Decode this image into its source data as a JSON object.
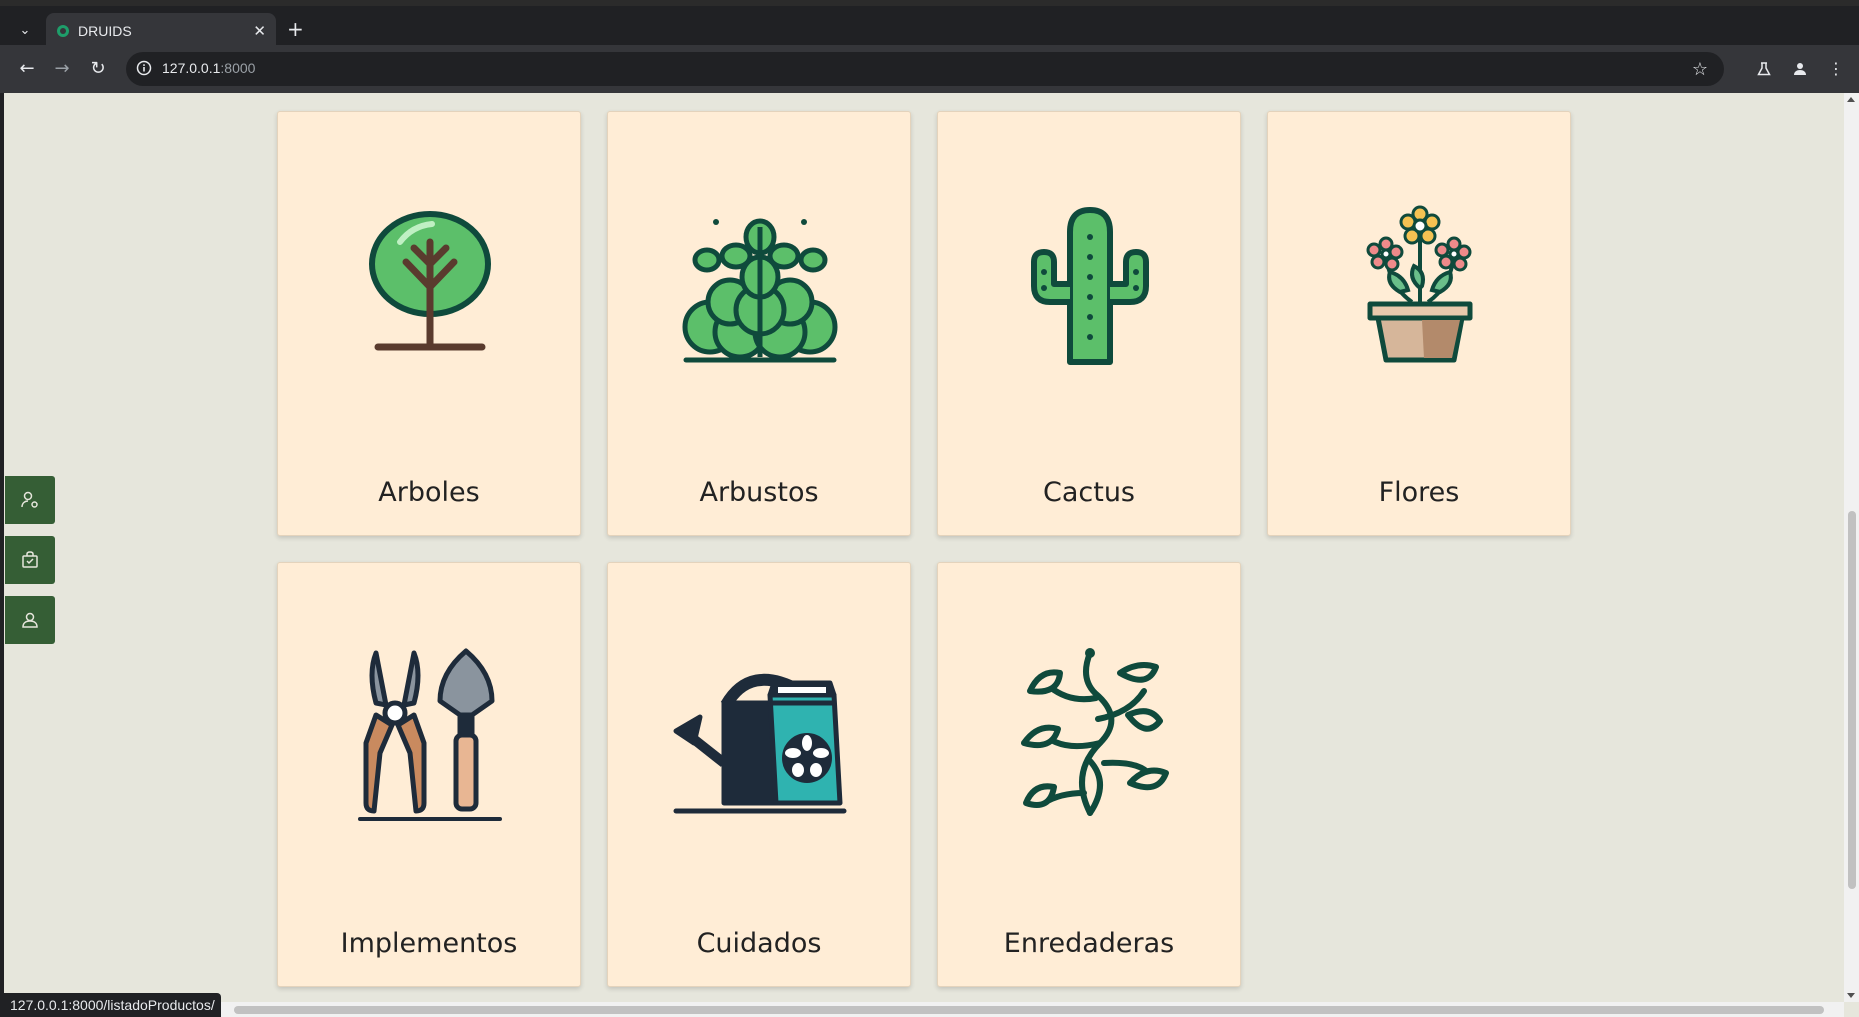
{
  "browser": {
    "tab_title": "DRUIDS",
    "tab_close": "✕",
    "new_tab": "+",
    "url_host": "127.0.0.1",
    "url_port": ":8000",
    "status_url": "127.0.0.1:8000/listadoProductos/"
  },
  "categories": [
    {
      "label": "Arboles",
      "icon": "tree-icon"
    },
    {
      "label": "Arbustos",
      "icon": "shrub-icon"
    },
    {
      "label": "Cactus",
      "icon": "cactus-icon"
    },
    {
      "label": "Flores",
      "icon": "flower-pot-icon"
    },
    {
      "label": "Implementos",
      "icon": "garden-tools-icon"
    },
    {
      "label": "Cuidados",
      "icon": "watering-can-icon"
    },
    {
      "label": "Enredaderas",
      "icon": "vine-icon"
    }
  ],
  "sidebar": [
    {
      "icon": "user-settings-icon"
    },
    {
      "icon": "shopping-bag-icon"
    },
    {
      "icon": "users-icon"
    }
  ],
  "colors": {
    "page_bg": "#e6e6dc",
    "card_bg": "#ffedd6",
    "sidebar_bg": "#355e35",
    "leaf_green": "#5cbf6a",
    "dark_outline": "#0f4a3c"
  }
}
